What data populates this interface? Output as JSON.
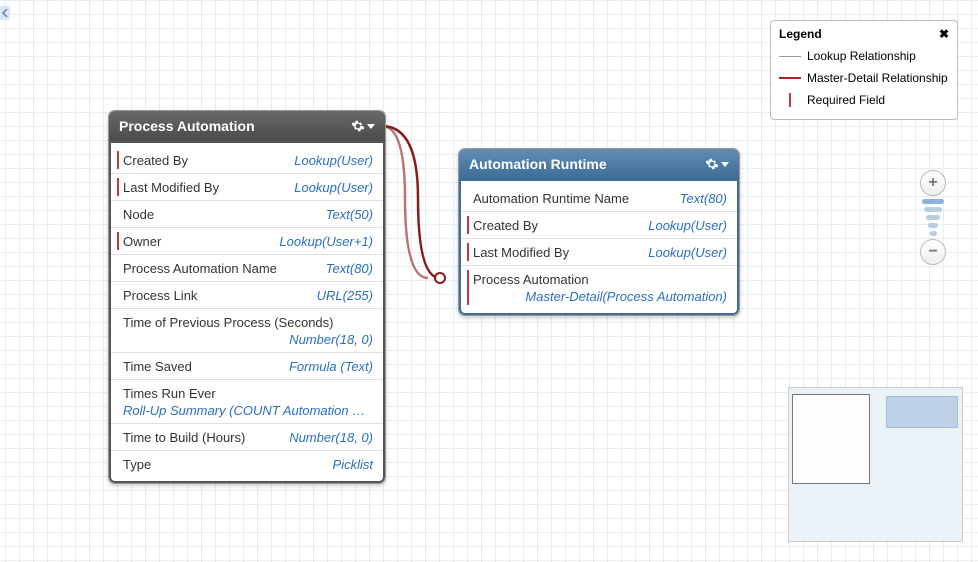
{
  "entities": {
    "process_automation": {
      "title": "Process Automation",
      "fields": [
        {
          "name": "Created By",
          "type": "Lookup(User)",
          "required": true
        },
        {
          "name": "Last Modified By",
          "type": "Lookup(User)",
          "required": true
        },
        {
          "name": "Node",
          "type": "Text(50)",
          "required": false
        },
        {
          "name": "Owner",
          "type": "Lookup(User+1)",
          "required": true
        },
        {
          "name": "Process Automation Name",
          "type": "Text(80)",
          "required": false
        },
        {
          "name": "Process Link",
          "type": "URL(255)",
          "required": false
        },
        {
          "name": "Time of Previous Process (Seconds)",
          "type": "Number(18, 0)",
          "required": false,
          "wrap": true
        },
        {
          "name": "Time Saved",
          "type": "Formula (Text)",
          "required": false
        },
        {
          "name": "Times Run Ever",
          "type": "Roll-Up Summary (COUNT Automation Runtime)",
          "required": false,
          "wrap2": true
        },
        {
          "name": "Time to Build (Hours)",
          "type": "Number(18, 0)",
          "required": false
        },
        {
          "name": "Type",
          "type": "Picklist",
          "required": false
        }
      ]
    },
    "automation_runtime": {
      "title": "Automation Runtime",
      "fields": [
        {
          "name": "Automation Runtime Name",
          "type": "Text(80)",
          "required": false
        },
        {
          "name": "Created By",
          "type": "Lookup(User)",
          "required": true
        },
        {
          "name": "Last Modified By",
          "type": "Lookup(User)",
          "required": true
        },
        {
          "name": "Process Automation",
          "type": "Master-Detail(Process Automation)",
          "required": true,
          "wrap": true
        }
      ]
    }
  },
  "legend": {
    "title": "Legend",
    "lookup": "Lookup Relationship",
    "md": "Master-Detail Relationship",
    "req": "Required Field"
  },
  "zoom": {
    "in": "+",
    "out": "−"
  }
}
